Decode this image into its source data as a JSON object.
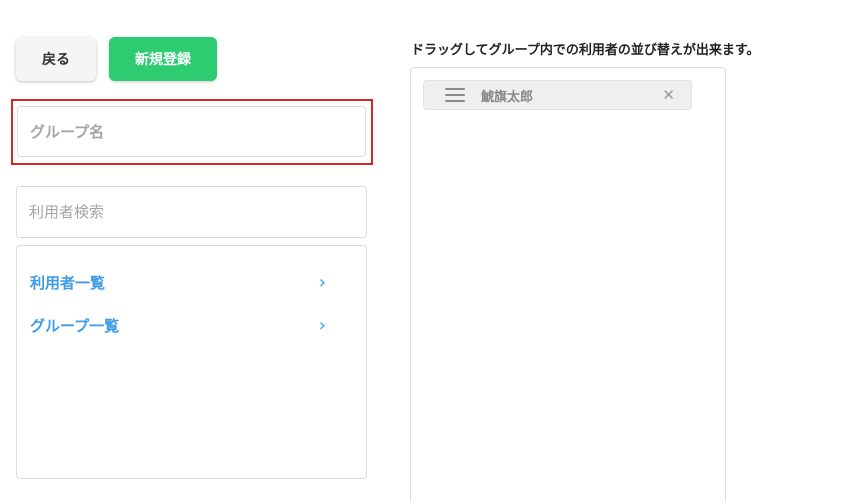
{
  "toolbar": {
    "back_label": "戻る",
    "new_label": "新規登録"
  },
  "form": {
    "group_name_placeholder": "グループ名",
    "user_search_placeholder": "利用者検索"
  },
  "nav": {
    "items": [
      {
        "label": "利用者一覧",
        "icon": "chevron-right-icon"
      },
      {
        "label": "グループ一覧",
        "icon": "chevron-right-icon"
      }
    ]
  },
  "members": {
    "title": "ドラッグしてグループ内での利用者の並び替えが出来ます。",
    "items": [
      {
        "name": "鯱旗太郎"
      }
    ]
  },
  "colors": {
    "accent_green": "#2ecc71",
    "link_blue": "#3d9be9",
    "highlight_red": "#e02424"
  }
}
